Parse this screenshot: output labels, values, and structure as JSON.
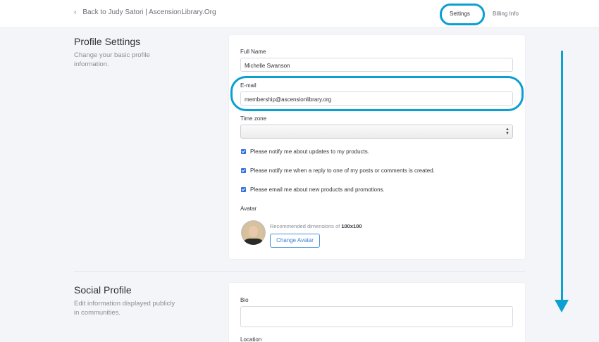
{
  "header": {
    "back_label": "Back to Judy Satori | AscensionLibrary.Org",
    "nav_settings": "Settings",
    "nav_billing": "Billing Info"
  },
  "profile": {
    "title": "Profile Settings",
    "description": "Change your basic profile information.",
    "full_name_label": "Full Name",
    "full_name_value": "Michelle Swanson",
    "email_label": "E-mail",
    "email_value": "membership@ascensionlibrary.org",
    "timezone_label": "Time zone",
    "timezone_value": "",
    "checkboxes": [
      {
        "label": "Please notify me about updates to my products.",
        "checked": true
      },
      {
        "label": "Please notify me when a reply to one of my posts or comments is created.",
        "checked": true
      },
      {
        "label": "Please email me about new products and promotions.",
        "checked": true
      }
    ],
    "avatar_label": "Avatar",
    "avatar_rec_prefix": "Recommended dimensions of",
    "avatar_rec_size": "100x100",
    "change_avatar": "Change Avatar"
  },
  "social": {
    "title": "Social Profile",
    "description": "Edit information displayed publicly in communities.",
    "bio_label": "Bio",
    "location_label": "Location"
  },
  "colors": {
    "highlight": "#0b9fd2",
    "accent": "#2f6fde",
    "background": "#f4f5f8"
  },
  "icons": {
    "back": "chevron-left-icon",
    "select": "select-arrows-icon",
    "scroll": "scroll-down-arrow-icon"
  }
}
